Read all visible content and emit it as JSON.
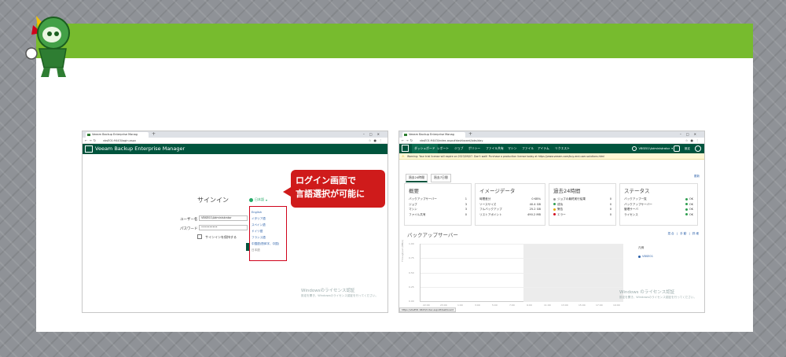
{
  "colors": {
    "band": "#77bb2e",
    "veeam": "#00543d",
    "callout": "#cf1b1b"
  },
  "left": {
    "tab": "Veeam Backup Enterprise Manag",
    "url": "vbsE01:9443/login.aspx",
    "app_title": "Veeam Backup Enterprise Manager",
    "signin": "サインイン",
    "language_button": "日本語",
    "user_label": "ユーザー名",
    "user_value": "VBSE01\\Administrator",
    "password_label": "パスワード",
    "password_value": "••••••••••",
    "remember": "サインインを保持する",
    "languages": [
      "English",
      "イタリア語",
      "スペイン語",
      "ドイツ語",
      "フランス語",
      "中国語(簡体字、中国)",
      "日本語"
    ],
    "callout": [
      "ログイン画面で",
      "言語選択が可能に"
    ],
    "watermark_title": "Windowsのライセンス認証",
    "watermark_text": "設定を開き、Windowsのライセンス認証を行ってください。"
  },
  "right": {
    "tab": "Veeam Backup Enterprise Manag",
    "url": "vbsE01:9443/index.aspx#dashboard/jobs/day",
    "menu": [
      "ダッシュボード",
      "レポート",
      "ジョブ",
      "ポリシー",
      "ファイル共有",
      "マシン",
      "ファイル",
      "アイテム",
      "リクエスト"
    ],
    "user": "VBSE01\\Administrator",
    "settings": "設定",
    "warning": "Warning: Your trial license will expire on 2023/09/07. Don't wait! Purchase a production license today at https://www.veeam.com/buy-end-user-solutions.html",
    "subtabs": [
      "過去24時間",
      "過去7日間"
    ],
    "refresh": "更新",
    "summary": {
      "title": "概要",
      "rows": [
        [
          "バックアップサーバー",
          "1"
        ],
        [
          "ジョブ",
          "3"
        ],
        [
          "マシン",
          "3"
        ],
        [
          "ファイル共有",
          "0"
        ]
      ]
    },
    "image": {
      "title": "イメージデータ",
      "rows": [
        [
          "時間差分",
          "0 KB%"
        ],
        [
          "ソースサイズ",
          "40.4 GB"
        ],
        [
          "フルバックアップ",
          "25.2 GB"
        ],
        [
          "リストアポイント",
          "490.2 MB"
        ]
      ]
    },
    "last24": {
      "title": "過去24時間",
      "rows": [
        [
          "ジョブの最終実行結果",
          "0"
        ],
        [
          "成功",
          "0"
        ],
        [
          "警告",
          "0"
        ],
        [
          "エラー",
          "0"
        ]
      ]
    },
    "status": {
      "title": "ステータス",
      "rows": [
        [
          "バックアップ一覧",
          "OK"
        ],
        [
          "バックアップサーバー",
          "OK"
        ],
        [
          "管理サーバ",
          "OK"
        ],
        [
          "ライセンス",
          "OK"
        ]
      ]
    },
    "chart_title": "バックアップサーバー",
    "chart_links": "混合 | 手動 | 詳細",
    "legend_title": "凡例",
    "legend_item": "VBSE01",
    "yticks": [
      "0.00",
      "0.25",
      "0.50",
      "0.75",
      "1.00"
    ],
    "xticks": [
      "22:00",
      "23:00",
      "1:00",
      "3:00",
      "5:00",
      "7:00",
      "9:00",
      "11:00",
      "13:00",
      "15:00",
      "17:00",
      "19:00"
    ],
    "y_axis_label": "Throughput (MB/s)",
    "watermark_title": "Windows のライセンス認証",
    "watermark_text": "設定を開き、Windowsのライセンス認証を行ってください。",
    "status_url": "https://vbsE01:9443/index.aspx#dashboard"
  }
}
